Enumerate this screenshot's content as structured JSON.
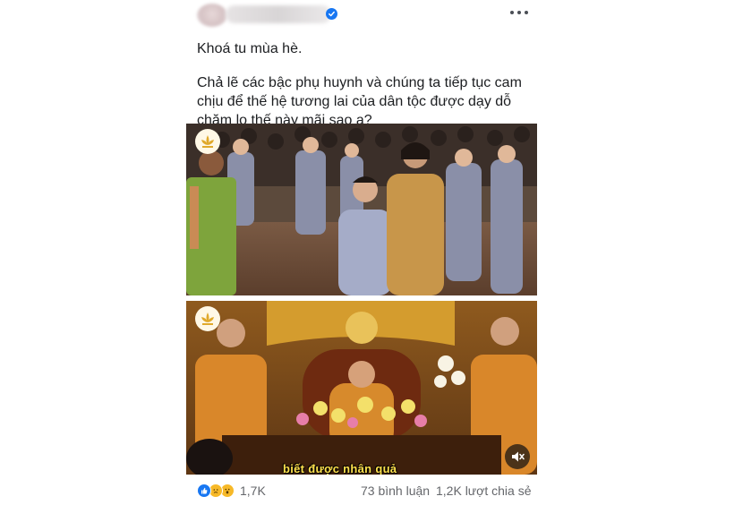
{
  "post": {
    "verified_icon": "verified-badge-icon",
    "more_icon": "more-options-icon",
    "title": "Khoá tu mùa hè.",
    "body": "Chả lẽ các bậc phụ huynh và chúng ta tiếp tục cam chịu để thế hệ tương lai của dân tộc được dạy dỗ chăm lo thế này mãi sao ạ?"
  },
  "media": {
    "video_caption": "biết được nhân quả",
    "mute_icon": "speaker-muted-icon",
    "logo_icon": "lotus-logo-icon"
  },
  "footer": {
    "reaction_icons": [
      "like-icon",
      "sad-icon",
      "wow-icon"
    ],
    "reaction_count": "1,7K",
    "comments": "73 bình luận",
    "shares": "1,2K lượt chia sẻ"
  },
  "colors": {
    "accent": "#1877f2",
    "text": "#1c1e21",
    "secondary_text": "#65676b",
    "caption": "#ffe14d"
  }
}
